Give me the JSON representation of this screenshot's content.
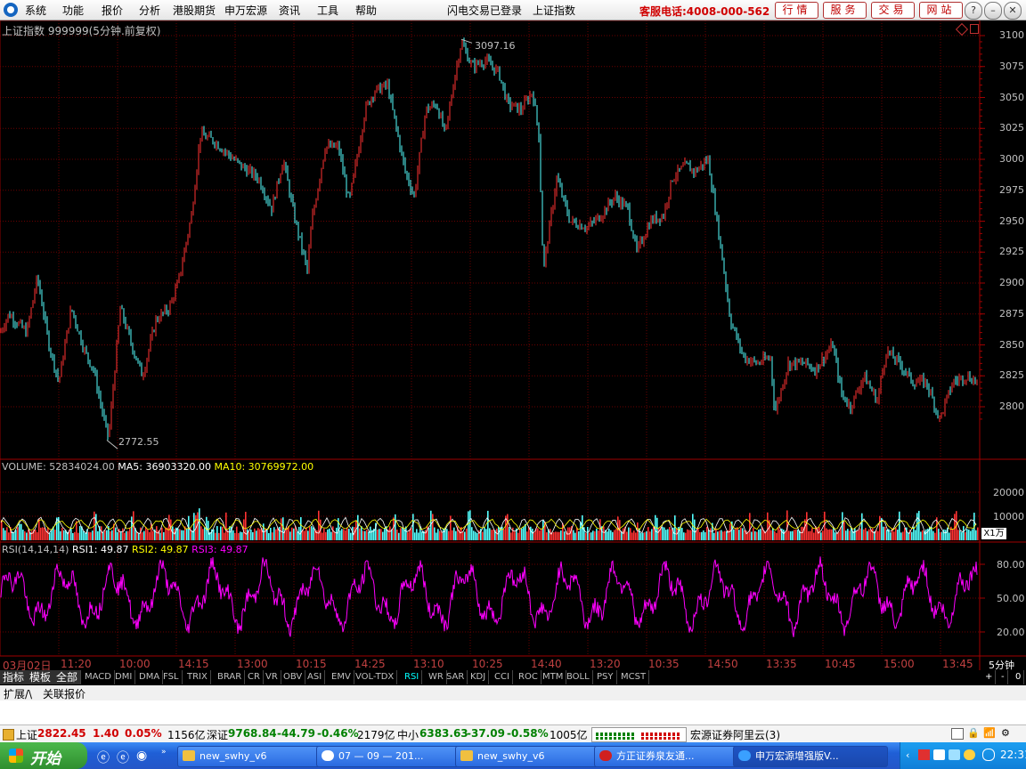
{
  "menu": {
    "items": [
      "系统",
      "功能",
      "报价",
      "分析",
      "港股期货",
      "申万宏源",
      "资讯",
      "工具",
      "帮助"
    ],
    "status": "闪电交易已登录",
    "index_name": "上证指数",
    "hotline": "客服电话:4008-000-562",
    "buttons": [
      "行情",
      "服务",
      "交易",
      "网站"
    ]
  },
  "chart": {
    "title": "上证指数 999999(5分钟.前复权)",
    "high_label": "3097.16",
    "low_label": "2772.55",
    "y_ticks": [
      "3100",
      "3075",
      "3050",
      "3025",
      "3000",
      "2975",
      "2950",
      "2925",
      "2900",
      "2875",
      "2850",
      "2825",
      "2800"
    ]
  },
  "volume": {
    "label": "VOLUME: 52834024.00",
    "ma5": "MA5: 36903320.00",
    "ma10": "MA10: 30769972.00",
    "ticks": [
      "20000",
      "10000"
    ],
    "unit": "X1万"
  },
  "rsi": {
    "label": "RSI(14,14,14)",
    "rsi1": "RSI1: 49.87",
    "rsi2": "RSI2: 49.87",
    "rsi3": "RSI3: 49.87",
    "ticks": [
      "80.00",
      "50.00",
      "20.00"
    ]
  },
  "time_axis": {
    "labels": [
      "03月02日",
      "11:20",
      "10:00",
      "14:15",
      "13:00",
      "10:15",
      "14:25",
      "13:10",
      "10:25",
      "14:40",
      "13:20",
      "10:35",
      "14:50",
      "13:35",
      "10:45",
      "15:00",
      "13:45"
    ],
    "period": "5分钟"
  },
  "tabs": [
    "指标",
    "模板",
    "全部",
    "MACD",
    "DMI",
    "DMA",
    "FSL",
    "TRIX",
    "BRAR",
    "CR",
    "VR",
    "OBV",
    "ASI",
    "EMV",
    "VOL-TDX",
    "RSI",
    "WR",
    "SAR",
    "KDJ",
    "CCI",
    "ROC",
    "MTM",
    "BOLL",
    "PSY",
    "MCST"
  ],
  "tab_controls": [
    "+",
    "-",
    "0"
  ],
  "ext_bar": [
    "扩展/\\",
    "关联报价"
  ],
  "status_bar": {
    "sh_name": "上证",
    "sh_value": "2822.45",
    "sh_change": "1.40",
    "sh_pct": "0.05%",
    "sh_amount": "1156亿",
    "sz_name": "深证",
    "sz_value": "9768.84",
    "sz_change": "-44.79",
    "sz_pct": "-0.46%",
    "sz_amount": "2179亿",
    "zx_name": "中小",
    "zx_value": "6383.63",
    "zx_change": "-37.09",
    "zx_pct": "-0.58%",
    "zx_amount": "1005亿",
    "server": "宏源证券阿里云(3)"
  },
  "taskbar": {
    "start": "开始",
    "windows": [
      "new_swhy_v6",
      "07 — 09 — 201...",
      "new_swhy_v6",
      "方正证券泉友通...",
      "申万宏源增强版V..."
    ],
    "clock": "22:31"
  },
  "colors": {
    "up": "#ff3232",
    "down": "#54ffff",
    "rsi": "#ff00ff",
    "ma5": "#ffffff",
    "ma10": "#ffff00",
    "grid": "#6a0000"
  }
}
